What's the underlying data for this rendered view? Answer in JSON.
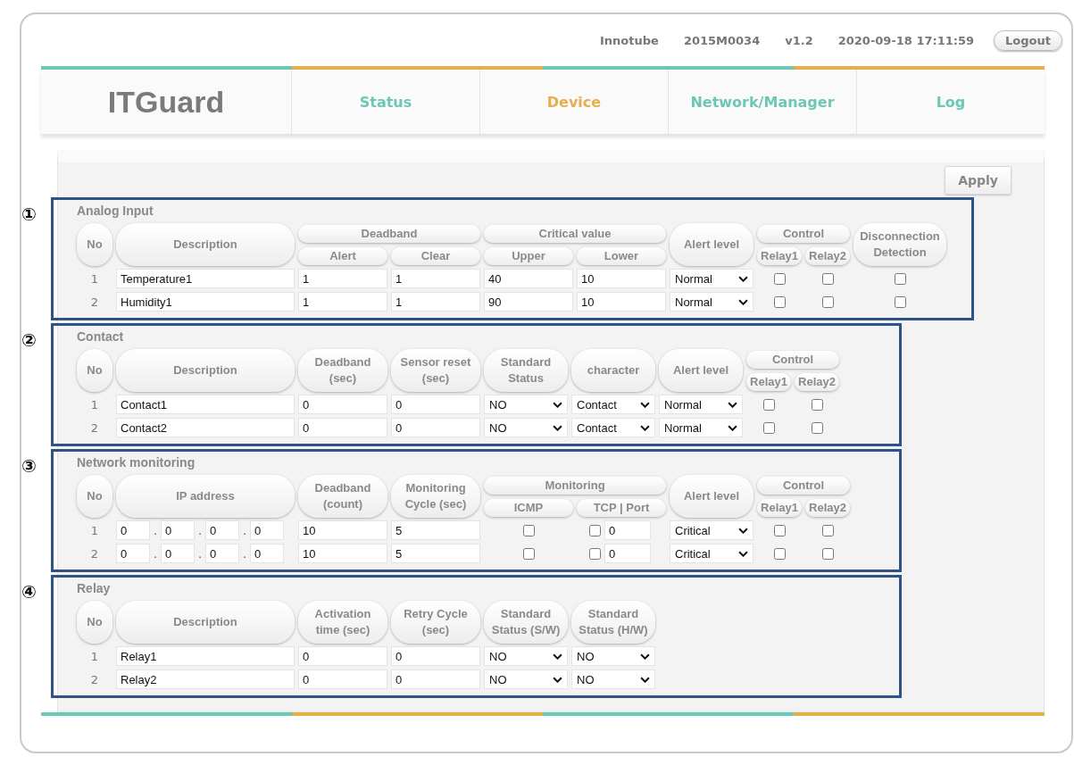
{
  "header": {
    "items": [
      "Innotube",
      "2015M0034",
      "v1.2",
      "2020-09-18 17:11:59"
    ],
    "logout": "Logout"
  },
  "nav": {
    "logo": "ITGuard",
    "tabs": [
      {
        "label": "Status",
        "selected": false
      },
      {
        "label": "Device",
        "selected": true
      },
      {
        "label": "Network/Manager",
        "selected": false
      },
      {
        "label": "Log",
        "selected": false
      }
    ]
  },
  "apply": "Apply",
  "sections": [
    {
      "marker": "①",
      "title": "Analog Input",
      "columns": [
        {
          "label": "No",
          "kind": "no"
        },
        {
          "label": "Description",
          "kind": "desc"
        },
        {
          "label": "Deadband",
          "colspan": 2,
          "children": [
            {
              "label": "Alert",
              "kind": "field"
            },
            {
              "label": "Clear",
              "kind": "field"
            }
          ]
        },
        {
          "label": "Critical value",
          "colspan": 2,
          "children": [
            {
              "label": "Upper",
              "kind": "field"
            },
            {
              "label": "Lower",
              "kind": "field"
            }
          ]
        },
        {
          "label": "Alert level",
          "kind": "select"
        },
        {
          "label": "Control",
          "colspan": 2,
          "children": [
            {
              "label": "Relay1",
              "kind": "check"
            },
            {
              "label": "Relay2",
              "kind": "check"
            }
          ]
        },
        {
          "label": "Disconnection Detection",
          "kind": "wide"
        }
      ],
      "rows": [
        {
          "cells": [
            {
              "kind": "no",
              "value": "1"
            },
            {
              "kind": "text",
              "value": "Temperature1"
            },
            {
              "kind": "text",
              "value": "1"
            },
            {
              "kind": "text",
              "value": "1"
            },
            {
              "kind": "text",
              "value": "40"
            },
            {
              "kind": "text",
              "value": "10"
            },
            {
              "kind": "select",
              "value": "Normal"
            },
            {
              "kind": "checkbox",
              "checked": false
            },
            {
              "kind": "checkbox",
              "checked": false
            },
            {
              "kind": "checkbox",
              "checked": false
            }
          ]
        },
        {
          "cells": [
            {
              "kind": "no",
              "value": "2"
            },
            {
              "kind": "text",
              "value": "Humidity1"
            },
            {
              "kind": "text",
              "value": "1"
            },
            {
              "kind": "text",
              "value": "1"
            },
            {
              "kind": "text",
              "value": "90"
            },
            {
              "kind": "text",
              "value": "10"
            },
            {
              "kind": "select",
              "value": "Normal"
            },
            {
              "kind": "checkbox",
              "checked": false
            },
            {
              "kind": "checkbox",
              "checked": false
            },
            {
              "kind": "checkbox",
              "checked": false
            }
          ]
        }
      ]
    },
    {
      "marker": "②",
      "title": "Contact",
      "columns": [
        {
          "label": "No",
          "kind": "no"
        },
        {
          "label": "Description",
          "kind": "desc"
        },
        {
          "label": "Deadband (sec)",
          "kind": "field"
        },
        {
          "label": "Sensor reset (sec)",
          "kind": "field"
        },
        {
          "label": "Standard Status",
          "kind": "select"
        },
        {
          "label": "character",
          "kind": "select"
        },
        {
          "label": "Alert level",
          "kind": "select"
        },
        {
          "label": "Control",
          "colspan": 2,
          "children": [
            {
              "label": "Relay1",
              "kind": "check"
            },
            {
              "label": "Relay2",
              "kind": "check"
            }
          ]
        }
      ],
      "rows": [
        {
          "cells": [
            {
              "kind": "no",
              "value": "1"
            },
            {
              "kind": "text",
              "value": "Contact1"
            },
            {
              "kind": "text",
              "value": "0"
            },
            {
              "kind": "text",
              "value": "0"
            },
            {
              "kind": "select",
              "value": "NO"
            },
            {
              "kind": "select",
              "value": "Contact"
            },
            {
              "kind": "select",
              "value": "Normal"
            },
            {
              "kind": "checkbox",
              "checked": false
            },
            {
              "kind": "checkbox",
              "checked": false
            }
          ]
        },
        {
          "cells": [
            {
              "kind": "no",
              "value": "2"
            },
            {
              "kind": "text",
              "value": "Contact2"
            },
            {
              "kind": "text",
              "value": "0"
            },
            {
              "kind": "text",
              "value": "0"
            },
            {
              "kind": "select",
              "value": "NO"
            },
            {
              "kind": "select",
              "value": "Contact"
            },
            {
              "kind": "select",
              "value": "Normal"
            },
            {
              "kind": "checkbox",
              "checked": false
            },
            {
              "kind": "checkbox",
              "checked": false
            }
          ]
        }
      ]
    },
    {
      "marker": "③",
      "title": "Network monitoring",
      "columns": [
        {
          "label": "No",
          "kind": "no"
        },
        {
          "label": "IP address",
          "kind": "ip"
        },
        {
          "label": "Deadband (count)",
          "kind": "field"
        },
        {
          "label": "Monitoring Cycle (sec)",
          "kind": "field"
        },
        {
          "label": "Monitoring",
          "colspan": 2,
          "children": [
            {
              "label": "ICMP",
              "kind": "field"
            },
            {
              "label": "TCP | Port",
              "kind": "field"
            }
          ]
        },
        {
          "label": "Alert level",
          "kind": "select"
        },
        {
          "label": "Control",
          "colspan": 2,
          "children": [
            {
              "label": "Relay1",
              "kind": "check"
            },
            {
              "label": "Relay2",
              "kind": "check"
            }
          ]
        }
      ],
      "rows": [
        {
          "cells": [
            {
              "kind": "no",
              "value": "1"
            },
            {
              "kind": "ip",
              "parts": [
                "0",
                "0",
                "0",
                "0"
              ],
              "separator": "."
            },
            {
              "kind": "text",
              "value": "10"
            },
            {
              "kind": "text",
              "value": "5"
            },
            {
              "kind": "checkbox",
              "checked": false
            },
            {
              "kind": "port",
              "checked": false,
              "value": "0"
            },
            {
              "kind": "select",
              "value": "Critical"
            },
            {
              "kind": "checkbox",
              "checked": false
            },
            {
              "kind": "checkbox",
              "checked": false
            }
          ]
        },
        {
          "cells": [
            {
              "kind": "no",
              "value": "2"
            },
            {
              "kind": "ip",
              "parts": [
                "0",
                "0",
                "0",
                "0"
              ],
              "separator": "."
            },
            {
              "kind": "text",
              "value": "10"
            },
            {
              "kind": "text",
              "value": "5"
            },
            {
              "kind": "checkbox",
              "checked": false
            },
            {
              "kind": "port",
              "checked": false,
              "value": "0"
            },
            {
              "kind": "select",
              "value": "Critical"
            },
            {
              "kind": "checkbox",
              "checked": false
            },
            {
              "kind": "checkbox",
              "checked": false
            }
          ]
        }
      ]
    },
    {
      "marker": "④",
      "title": "Relay",
      "columns": [
        {
          "label": "No",
          "kind": "no"
        },
        {
          "label": "Description",
          "kind": "desc"
        },
        {
          "label": "Activation time (sec)",
          "kind": "field"
        },
        {
          "label": "Retry Cycle (sec)",
          "kind": "field"
        },
        {
          "label": "Standard Status (S/W)",
          "kind": "select"
        },
        {
          "label": "Standard Status (H/W)",
          "kind": "select"
        }
      ],
      "rows": [
        {
          "cells": [
            {
              "kind": "no",
              "value": "1"
            },
            {
              "kind": "text",
              "value": "Relay1"
            },
            {
              "kind": "text",
              "value": "0"
            },
            {
              "kind": "text",
              "value": "0"
            },
            {
              "kind": "select",
              "value": "NO"
            },
            {
              "kind": "select",
              "value": "NO"
            }
          ]
        },
        {
          "cells": [
            {
              "kind": "no",
              "value": "2"
            },
            {
              "kind": "text",
              "value": "Relay2"
            },
            {
              "kind": "text",
              "value": "0"
            },
            {
              "kind": "text",
              "value": "0"
            },
            {
              "kind": "select",
              "value": "NO"
            },
            {
              "kind": "select",
              "value": "NO"
            }
          ]
        }
      ]
    }
  ]
}
